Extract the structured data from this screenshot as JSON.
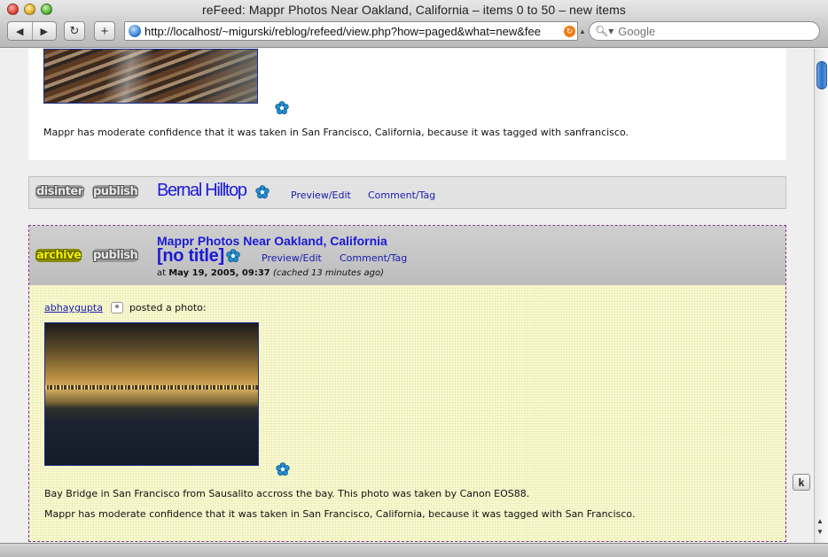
{
  "window": {
    "title": "reFeed: Mappr Photos Near Oakland, California – items 0 to 50 – new items"
  },
  "toolbar": {
    "back_icon": "◀",
    "forward_icon": "▶",
    "reload_icon": "↻",
    "add_icon": "+",
    "url": "http://localhost/~migurski/reblog/refeed/view.php?how=paged&what=new&fee",
    "rss_icon": "↻",
    "search_placeholder": "Google"
  },
  "post1": {
    "confidence_text": "Mappr has moderate confidence that it was taken in San Francisco, California, because it was tagged with sanfrancisco."
  },
  "bar1": {
    "disinter_label": "disinter",
    "publish_label": "publish",
    "title": "Bernal Hilltop",
    "preview_edit": "Preview/Edit",
    "comment_tag": "Comment/Tag"
  },
  "post2": {
    "archive_label": "archive",
    "publish_label": "publish",
    "source": "Mappr Photos Near Oakland, California",
    "title": "[no title]",
    "preview_edit": "Preview/Edit",
    "comment_tag": "Comment/Tag",
    "date_prefix": "at ",
    "date": "May 19, 2005, 09:37",
    "cached": "(cached 13 minutes ago)",
    "author": "abhaygupta",
    "posted_text": "posted a photo:",
    "caption": "Bay Bridge in San Francisco from Sausalito accross the bay. This photo was taken by Canon EOS88.",
    "confidence_text": "Mappr has moderate confidence that it was taken in San Francisco, California, because it was tagged with San Francisco."
  },
  "k_button": "k",
  "colors": {
    "link": "#1a1ad8",
    "archive_bg": "#fafad0",
    "archive_border": "#7a3a9a"
  }
}
